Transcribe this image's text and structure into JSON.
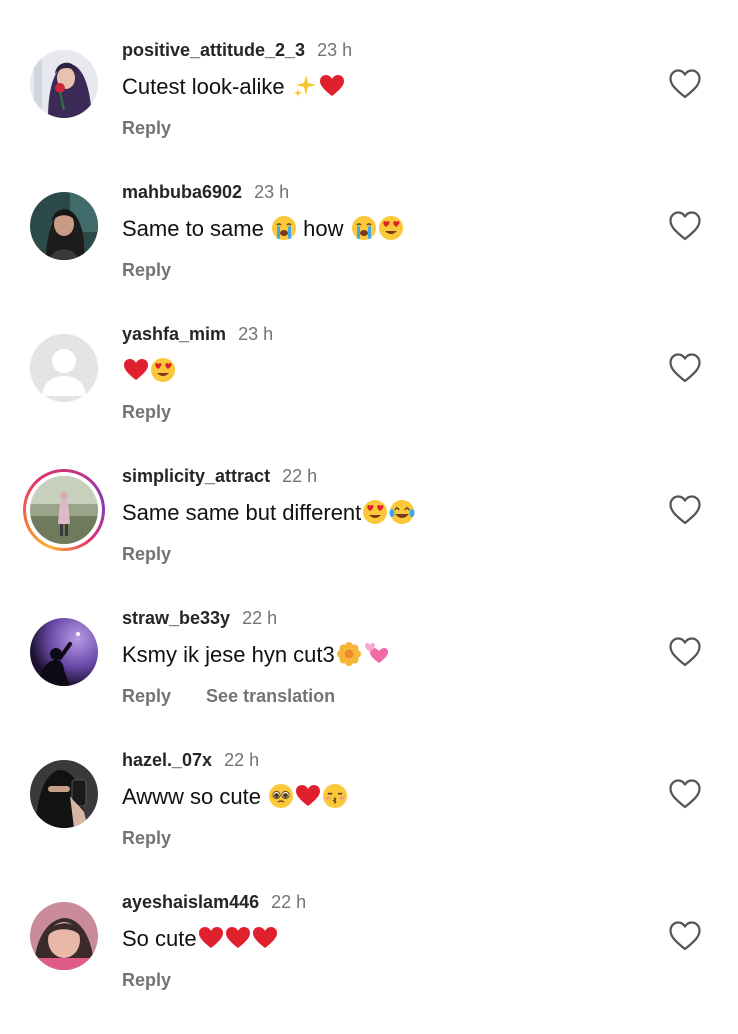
{
  "comments": [
    {
      "username": "positive_attitude_2_3",
      "time": "23 h",
      "text": "Cutest look-alike",
      "emojis": [
        "sparkles-emoji",
        "red-heart-emoji"
      ],
      "reply": "Reply",
      "avatar": "woman-with-rose-avatar"
    },
    {
      "username": "mahbuba6902",
      "time": "23 h",
      "text": "Same to same",
      "mid_emojis": [
        "loudly-crying-emoji"
      ],
      "text2": "how",
      "emojis": [
        "loudly-crying-emoji",
        "heart-eyes-emoji"
      ],
      "reply": "Reply",
      "avatar": "woman-portrait-avatar"
    },
    {
      "username": "yashfa_mim",
      "time": "23 h",
      "text": "",
      "emojis": [
        "red-heart-emoji",
        "heart-eyes-emoji"
      ],
      "reply": "Reply",
      "avatar": "default-user-avatar"
    },
    {
      "username": "simplicity_attract",
      "time": "22 h",
      "text": "Same same but different",
      "emojis": [
        "heart-eyes-emoji",
        "tears-of-joy-emoji"
      ],
      "reply": "Reply",
      "avatar": "standing-figure-avatar"
    },
    {
      "username": "straw_be33y",
      "time": "22 h",
      "text": "Ksmy ik jese hyn cut3",
      "emojis": [
        "blossom-emoji",
        "revolving-hearts-emoji"
      ],
      "reply": "Reply",
      "see_translation": "See translation",
      "avatar": "silhouette-purple-avatar"
    },
    {
      "username": "hazel._07x",
      "time": "22 h",
      "text": "Awww so cute",
      "emojis": [
        "pleading-face-emoji",
        "red-heart-emoji",
        "kissing-face-emoji"
      ],
      "reply": "Reply",
      "avatar": "veiled-selfie-avatar"
    },
    {
      "username": "ayeshaislam446",
      "time": "22 h",
      "text": "So cute",
      "emojis": [
        "red-heart-emoji",
        "red-heart-emoji",
        "red-heart-emoji"
      ],
      "reply": "Reply",
      "avatar": "girl-pink-avatar"
    }
  ]
}
